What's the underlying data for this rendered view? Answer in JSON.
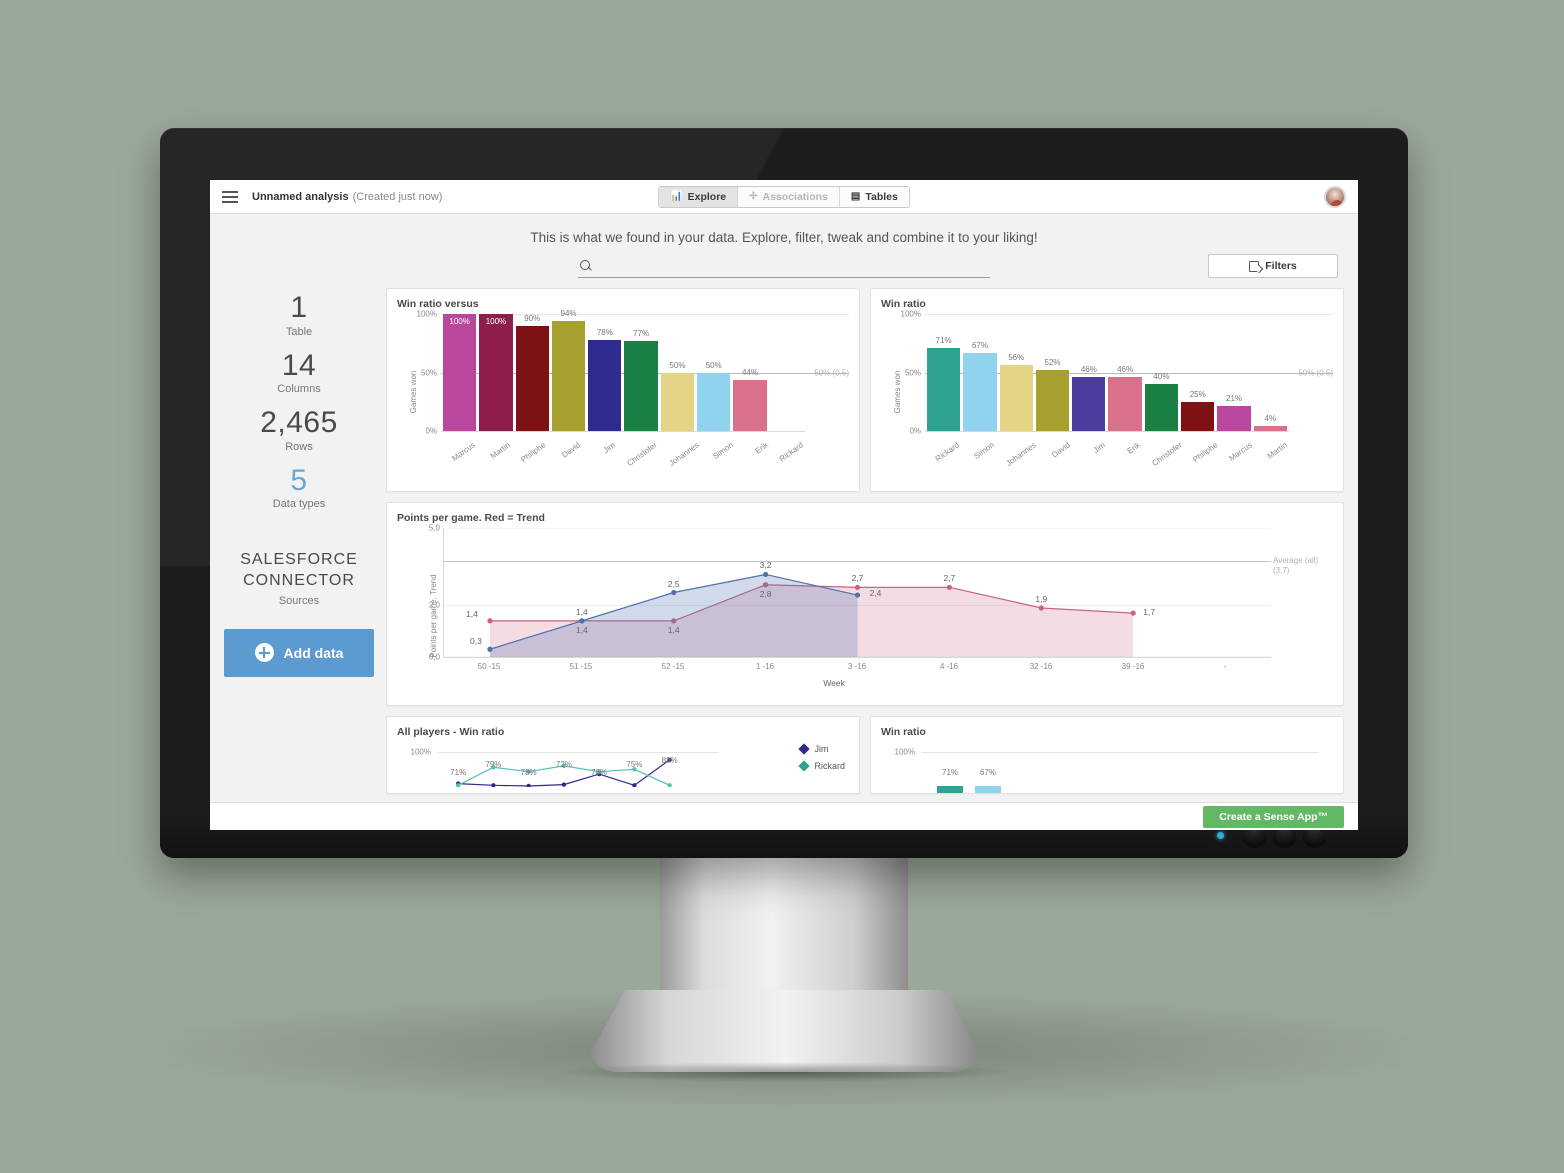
{
  "topbar": {
    "menu_icon": "hamburger-icon",
    "title": "Unnamed analysis",
    "subtitle": "(Created just now)",
    "tabs": [
      {
        "label": "Explore",
        "icon": "bar-chart-icon",
        "active": true
      },
      {
        "label": "Associations",
        "icon": "associations-icon",
        "active": false
      },
      {
        "label": "Tables",
        "icon": "table-icon",
        "active": false
      }
    ],
    "avatar": "user-avatar"
  },
  "headline": "This is what we found in your data. Explore, filter, tweak and combine it to your liking!",
  "search": {
    "placeholder": "",
    "value": "",
    "icon": "search-icon"
  },
  "filters_button": {
    "label": "Filters",
    "icon": "filter-icon"
  },
  "sidebar": {
    "stats": [
      {
        "value": "1",
        "label": "Table",
        "accent": false
      },
      {
        "value": "14",
        "label": "Columns",
        "accent": false
      },
      {
        "value": "2,465",
        "label": "Rows",
        "accent": false
      },
      {
        "value": "5",
        "label": "Data types",
        "accent": true
      }
    ],
    "sources": {
      "name": "SALESFORCE CONNECTOR",
      "label": "Sources"
    },
    "add_data_button": {
      "label": "Add data",
      "icon": "plus-circle-icon"
    }
  },
  "bottombar": {
    "create_app_label": "Create a Sense App™"
  },
  "colors": {
    "accent_blue": "#6ba7d4",
    "button_blue": "#5b9bd0",
    "green": "#62b865",
    "trend_red": "#c9637f",
    "series_blue": "#4f6fb0"
  },
  "chart_data": [
    {
      "id": "win-ratio-versus",
      "type": "bar",
      "title": "Win ratio versus",
      "xlabel": "",
      "ylabel": "Games won",
      "ylim": [
        0,
        100
      ],
      "yticks": [
        "0%",
        "50%",
        "100%"
      ],
      "reference_line": {
        "value": 50,
        "label": "50% (0.5)"
      },
      "categories": [
        "Marcus",
        "Martin",
        "Philiphe",
        "David",
        "Jim",
        "Christofer",
        "Johannes",
        "Simon",
        "Erik",
        "Rickard"
      ],
      "values": [
        100,
        100,
        90,
        94,
        78,
        77,
        50,
        50,
        44,
        0
      ],
      "value_labels": [
        "100%",
        "100%",
        "90%",
        "94%",
        "78%",
        "77%",
        "50%",
        "50%",
        "44%",
        ""
      ],
      "bar_colors": [
        "#b9479e",
        "#8e1f4c",
        "#7d1113",
        "#a8a02e",
        "#2e2a8e",
        "#1a8044",
        "#e3d486",
        "#8fd3ef",
        "#d9708c",
        "#ffffff"
      ]
    },
    {
      "id": "win-ratio",
      "type": "bar",
      "title": "Win ratio",
      "xlabel": "",
      "ylabel": "Games won",
      "ylim": [
        0,
        100
      ],
      "yticks": [
        "0%",
        "50%",
        "100%"
      ],
      "reference_line": {
        "value": 50,
        "label": "50% (0.5)"
      },
      "categories": [
        "Rickard",
        "Simon",
        "Johannes",
        "David",
        "Jim",
        "Erik",
        "Christofer",
        "Philiphe",
        "Marcus",
        "Martin"
      ],
      "values": [
        71,
        67,
        56,
        52,
        46,
        46,
        40,
        25,
        21,
        4
      ],
      "value_labels": [
        "71%",
        "67%",
        "56%",
        "52%",
        "46%",
        "46%",
        "40%",
        "25%",
        "21%",
        "4%"
      ],
      "bar_colors": [
        "#2fa392",
        "#8fd3ef",
        "#e3d486",
        "#a8a02e",
        "#4a3d9e",
        "#d9708c",
        "#1a8044",
        "#7d1113",
        "#b9479e",
        "#d9708c"
      ]
    },
    {
      "id": "points-per-game",
      "type": "area",
      "title": "Points per game. Red = Trend",
      "xlabel": "Week",
      "ylabel": "Points per game, Trend",
      "ylim": [
        0,
        5
      ],
      "yticks": [
        "0,0",
        "2,0",
        "5,0"
      ],
      "x": [
        "50 -15",
        "51 -15",
        "52 -15",
        "1 -16",
        "3 -16",
        "4 -16",
        "32 -16",
        "39 -16",
        "-"
      ],
      "reference_line": {
        "label": "Average (all)",
        "sublabel": "(3,7)",
        "value": 3.7
      },
      "series": [
        {
          "name": "Points per game",
          "color": "#4f6fb0",
          "values": [
            0.3,
            1.4,
            2.5,
            3.2,
            2.4,
            null,
            null,
            null,
            null
          ],
          "labels": [
            "0,3",
            "1,4",
            "2,5",
            "3,2",
            "2,4",
            "",
            "",
            "",
            ""
          ]
        },
        {
          "name": "Trend",
          "color": "#c9637f",
          "values": [
            1.4,
            1.4,
            1.4,
            2.8,
            2.7,
            2.7,
            1.9,
            1.7,
            null
          ],
          "labels": [
            "1,4",
            "1,4",
            "1,4",
            "2,8",
            "2,7",
            "2,7",
            "1,9",
            "1,7",
            ""
          ]
        }
      ]
    },
    {
      "id": "all-players-win-ratio",
      "type": "line",
      "title": "All players - Win ratio",
      "ylim": [
        0,
        100
      ],
      "yticks": [
        "100%"
      ],
      "legend": [
        {
          "name": "Jim",
          "color": "#2e2a8e"
        },
        {
          "name": "Rickard",
          "color": "#2fa392"
        }
      ],
      "point_labels": [
        "71%",
        "79%",
        "78%",
        "72%",
        "78%",
        "75%",
        "88%"
      ]
    },
    {
      "id": "win-ratio-bottom",
      "type": "bar",
      "title": "Win ratio",
      "ylim": [
        0,
        100
      ],
      "yticks": [
        "100%"
      ],
      "value_labels": [
        "71%",
        "67%"
      ],
      "bar_colors": [
        "#2fa392",
        "#8fd3ef"
      ]
    }
  ]
}
